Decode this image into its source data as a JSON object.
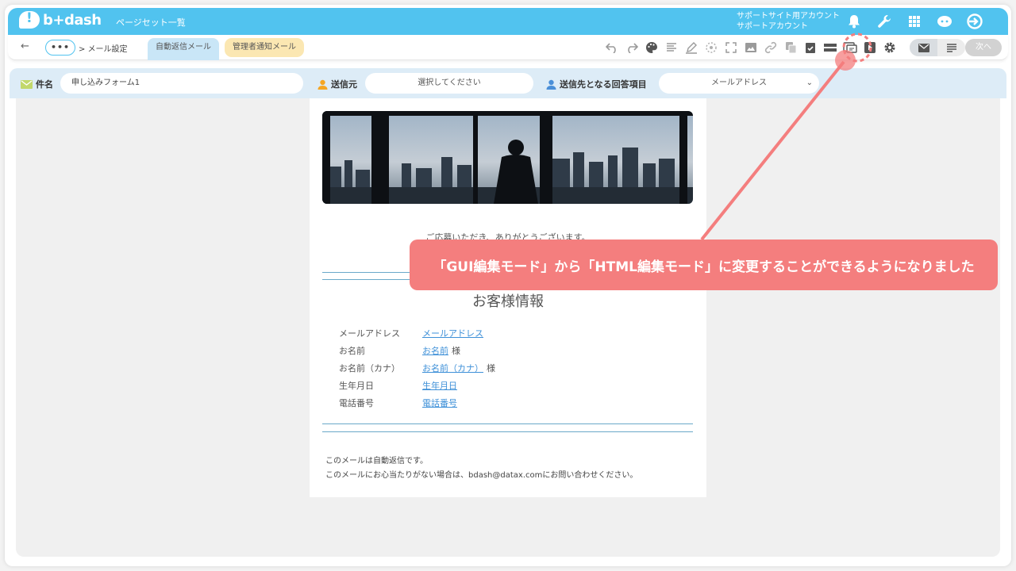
{
  "header": {
    "logo_text": "b+dash",
    "page_list_link": "ページセット一覧",
    "account_line1": "サポートサイト用アカウント",
    "account_line2": "サポートアカウント",
    "icons": [
      "bell-icon",
      "wrench-icon",
      "grid-icon",
      "feedback-icon",
      "logout-icon"
    ]
  },
  "toolbar": {
    "more_label": "•••",
    "breadcrumb": "> メール設定",
    "tabs": [
      {
        "label": "自動返信メール",
        "active": true
      },
      {
        "label": "管理者通知メール",
        "active": false
      }
    ],
    "next_label": "次へ",
    "icons": [
      "undo-icon",
      "redo-icon",
      "palette-icon",
      "text-align-icon",
      "pen-icon",
      "target-icon",
      "fullscreen-icon",
      "image-icon",
      "link-icon",
      "copy-icon",
      "checkbox-icon",
      "layout-icon",
      "html-mode-icon",
      "play-icon",
      "gear-icon"
    ]
  },
  "fieldbar": {
    "subject_label": "件名",
    "subject_value": "申し込みフォーム1",
    "sender_label": "送信元",
    "sender_value": "選択してください",
    "recipient_label": "送信先となる回答項目",
    "recipient_value": "メールアドレス"
  },
  "mail": {
    "thanks": "ご応募いただき、ありがとうございます。",
    "info_title": "お客様情報",
    "rows": [
      {
        "key": "メールアドレス",
        "value": "メールアドレス",
        "suffix": ""
      },
      {
        "key": "お名前",
        "value": "お名前",
        "suffix": "様"
      },
      {
        "key": "お名前（カナ）",
        "value": "お名前（カナ）",
        "suffix": "様"
      },
      {
        "key": "生年月日",
        "value": "生年月日",
        "suffix": ""
      },
      {
        "key": "電話番号",
        "value": "電話番号",
        "suffix": ""
      }
    ],
    "footer_line1": "このメールは自動返信です。",
    "footer_line2": "このメールにお心当たりがない場合は、bdash@datax.comにお問い合わせください。"
  },
  "annotation": {
    "text": "「GUI編集モード」から「HTML編集モード」に変更することができるようになりました",
    "color": "#f47e7e"
  },
  "colors": {
    "brand": "#51c3ef",
    "link": "#3e90d8"
  }
}
